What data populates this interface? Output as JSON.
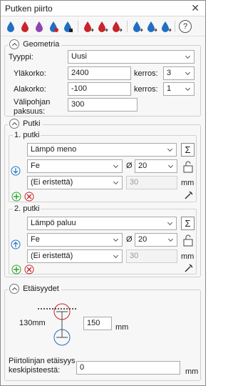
{
  "window": {
    "title": "Putken piirto",
    "close": "✕"
  },
  "toolbar": {
    "help": "?"
  },
  "geometria": {
    "title": "Geometria",
    "tyyppi_label": "Tyyppi:",
    "tyyppi_value": "Uusi",
    "ylakorko_label": "Yläkorko:",
    "ylakorko_value": "2400",
    "kerros_label": "kerros:",
    "kerros1_value": "3",
    "alakorko_label": "Alakorko:",
    "alakorko_value": "-100",
    "kerros2_label": "kerros:",
    "kerros2_value": "1",
    "valipohja_label": "Välipohjan\npaksuus:",
    "valipohja_value": "300"
  },
  "putki": {
    "title": "Putki",
    "putki1": {
      "title": "1. putki",
      "type": "Lämpö meno",
      "material": "Fe",
      "diameter_symbol": "Ø",
      "diameter": "20",
      "insulation": "(Ei eristettä)",
      "insulation_thickness": "30",
      "unit": "mm"
    },
    "putki2": {
      "title": "2. putki",
      "type": "Lämpö paluu",
      "material": "Fe",
      "diameter_symbol": "Ø",
      "diameter": "20",
      "insulation": "(Ei eristettä)",
      "insulation_thickness": "30",
      "unit": "mm"
    }
  },
  "etaisyydet": {
    "title": "Etäisyydet",
    "dim_label": "130mm",
    "distance_value": "150",
    "distance_unit": "mm",
    "center_label": "Piirtolinjan etäisyys\nkeskipisteestä:",
    "center_value": "0",
    "center_unit": "mm"
  },
  "colors": {
    "red": "#c8242b",
    "blue": "#1f6fc5",
    "purple": "#8e44ad",
    "green": "#2a9d2a"
  }
}
